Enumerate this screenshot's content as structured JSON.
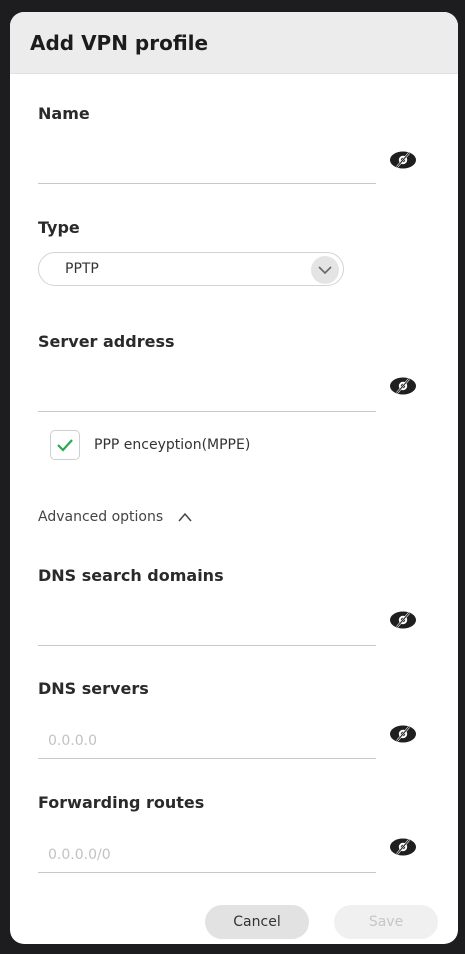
{
  "dialog": {
    "title": "Add VPN profile"
  },
  "fields": {
    "name": {
      "label": "Name",
      "value": "",
      "placeholder": ""
    },
    "type": {
      "label": "Type",
      "selected": "PPTP"
    },
    "server_address": {
      "label": "Server address",
      "value": "",
      "placeholder": ""
    },
    "ppp_encryption": {
      "label": "PPP enceyption(MPPE)",
      "checked": true
    },
    "advanced": {
      "label": "Advanced options",
      "expanded": true
    },
    "dns_search_domains": {
      "label": "DNS search domains",
      "value": "",
      "placeholder": ""
    },
    "dns_servers": {
      "label": "DNS servers",
      "value": "",
      "placeholder": "0.0.0.0"
    },
    "forwarding_routes": {
      "label": "Forwarding routes",
      "value": "",
      "placeholder": "0.0.0.0/0"
    }
  },
  "buttons": {
    "cancel": "Cancel",
    "save": "Save"
  },
  "icons": {
    "visibility": "eye-off-icon",
    "dropdown": "chevron-down-icon",
    "check": "checkmark-icon",
    "collapse": "chevron-up-icon"
  },
  "colors": {
    "check_accent": "#2fa84f",
    "header_bg": "#ececec",
    "backdrop": "#1d1d1f"
  }
}
